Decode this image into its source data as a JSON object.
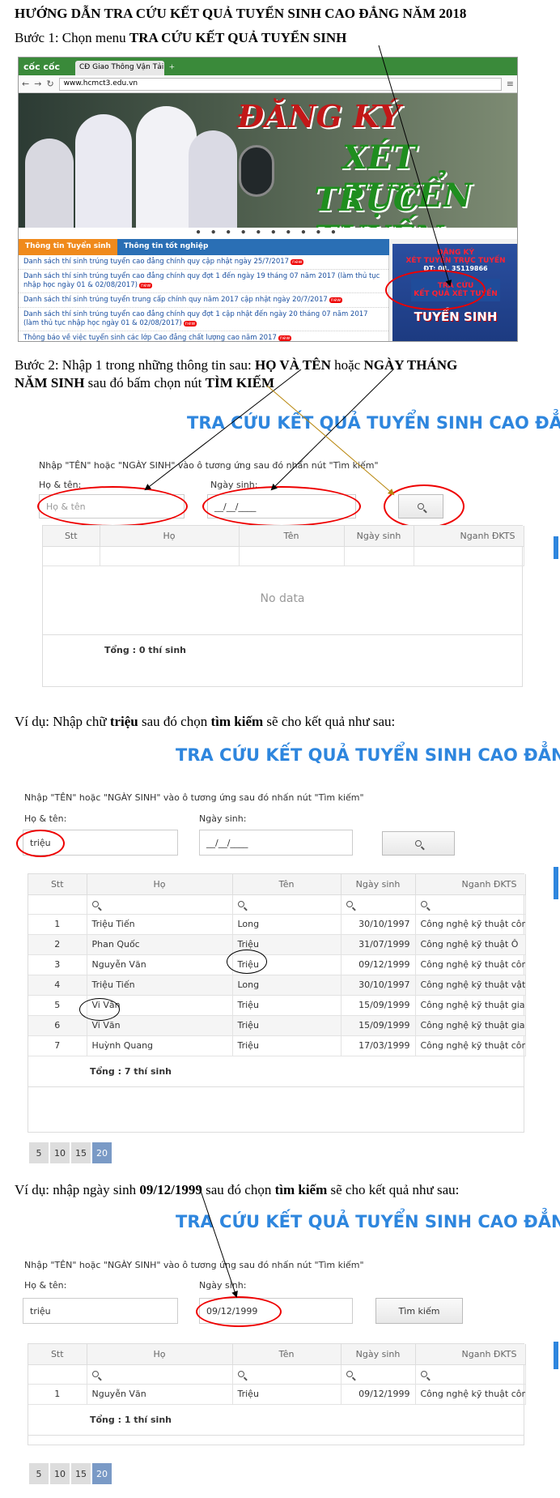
{
  "heading": "HƯỚNG DẪN TRA CỨU KẾT QUẢ TUYỂN SINH CAO ĐẲNG NĂM 2018",
  "step1": {
    "prefix": "Bước 1: Chọn menu ",
    "bold": "TRA CỨU KẾT QUẢ TUYỂN SINH"
  },
  "browser": {
    "logo": "cốc cốc",
    "tab_title": "CĐ Giao Thông Vận Tải 3",
    "url": "www.hcmct3.edu.vn",
    "banner_line1": "ĐĂNG KÝ",
    "banner_line2": "XÉT TUYỂN",
    "banner_line3": "TRỰC TUYẾN",
    "slider_dots": "● ● ● ● ● ● ● ● ● ●",
    "news_tabs": [
      "Thông tin Tuyển sinh",
      "Thông tin tốt nghiệp"
    ],
    "news_items": [
      "Danh sách thí sinh trúng tuyển cao đẳng chính quy cập nhật ngày 25/7/2017",
      "Danh sách thí sinh trúng tuyển cao đẳng chính quy đợt 1 đến ngày 19 tháng 07 năm 2017 (làm thủ tục nhập học ngày 01 & 02/08/2017)",
      "Danh sách thí sinh trúng tuyển trung cấp chính quy năm 2017 cập nhật ngày 20/7/2017",
      "Danh sách thí sinh trúng tuyển cao đẳng chính quy đợt 1 cập nhật đến ngày 20 tháng 07 năm 2017 (làm thủ tục nhập học ngày 01 & 02/08/2017)",
      "Thông báo về việc tuyển sinh các lớp Cao đẳng chất lượng cao năm 2017"
    ],
    "new_badge": "new",
    "side_line1": "ĐĂNG KÝ",
    "side_line2": "XÉT TUYỂN TRỰC TUYẾN",
    "side_phone": "ĐT: 08. 35119866",
    "side_line3": "TRA CỨU",
    "side_line4": "KẾT QUẢ XÉT TUYỂN",
    "side_line5": "TUYỂN SINH"
  },
  "step2": {
    "prefix": "Bước 2: Nhập 1 trong những thông tin sau: ",
    "bold1": "HỌ VÀ TÊN",
    "mid": " hoặc ",
    "bold2": "NGÀY THÁNG",
    "line2_bold": "NĂM SINH",
    "line2_mid": " sau đó bấm chọn nút ",
    "line2_bold2": "TÌM KIẾM"
  },
  "search_title": "TRA CỨU KẾT QUẢ TUYỂN SINH CAO ĐẲNG",
  "instruction": "Nhập \"TÊN\" hoặc \"NGÀY SINH\" vào ô tương ứng sau đó nhấn nút \"Tìm kiếm\"",
  "name_label": "Họ & tên:",
  "dob_label": "Ngày sinh:",
  "name_placeholder": "Họ & tên",
  "dob_mask": "__/__/____",
  "columns": [
    "Stt",
    "Họ",
    "Tên",
    "Ngày sinh",
    "Nganh ĐKTS"
  ],
  "no_data": "No data",
  "total_0": "Tổng : 0 thí sinh",
  "example1": {
    "prefix": "Ví dụ: Nhập chữ  ",
    "bold": "triệu",
    "mid": " sau đó chọn ",
    "bold2": "tìm kiếm",
    "suffix": " sẽ cho kết quả như sau:"
  },
  "example1_name_value": "triệu",
  "rows1": [
    [
      "1",
      "Triệu Tiến",
      "Long",
      "30/10/1997",
      "Công nghệ kỹ thuật côn"
    ],
    [
      "2",
      "Phan Quốc",
      "Triệu",
      "31/07/1999",
      "Công nghệ kỹ thuật Ô"
    ],
    [
      "3",
      "Nguyễn Văn",
      "Triệu",
      "09/12/1999",
      "Công nghệ kỹ thuật côn"
    ],
    [
      "4",
      "Triệu Tiến",
      "Long",
      "30/10/1997",
      "Công nghệ kỹ thuật vật"
    ],
    [
      "5",
      "Vi Văn",
      "Triệu",
      "15/09/1999",
      "Công nghệ kỹ thuật giao"
    ],
    [
      "6",
      "Vi Văn",
      "Triệu",
      "15/09/1999",
      "Công nghệ kỹ thuật giao"
    ],
    [
      "7",
      "Huỳnh Quang",
      "Triệu",
      "17/03/1999",
      "Công nghệ kỹ thuật côn"
    ]
  ],
  "total_7": "Tổng : 7 thí sinh",
  "pager": [
    "5",
    "10",
    "15",
    "20"
  ],
  "example2": {
    "prefix": "Ví dụ: nhập ngày sinh ",
    "bold": "09/12/1999",
    "mid": " sau đó chọn ",
    "bold2": "tìm kiếm",
    "suffix": " sẽ cho kết quả như sau:"
  },
  "example2_name_value": "triệu",
  "example2_dob_value": "09/12/1999",
  "search_button": "Tìm kiếm",
  "rows2": [
    [
      "1",
      "Nguyễn Văn",
      "Triệu",
      "09/12/1999",
      "Công nghệ kỹ thuật côn"
    ]
  ],
  "total_1": "Tổng : 1 thí sinh",
  "colors": {
    "accent_blue": "#2e86de",
    "annotation_red": "#e00000",
    "arrow_gold": "#b8860b",
    "pager_active": "#7a9ac6"
  }
}
